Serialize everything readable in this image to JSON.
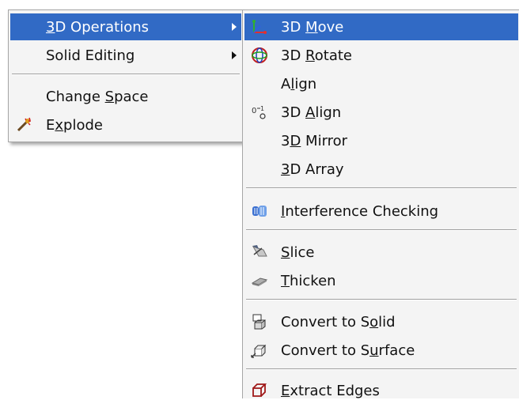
{
  "parent_menu": {
    "items": [
      {
        "label_pre": "",
        "label_ul": "3",
        "label_post": "D Operations",
        "has_submenu": true,
        "highlighted": true
      },
      {
        "label_pre": "Solid Editin",
        "label_ul": "g",
        "label_post": "",
        "has_submenu": true
      },
      {
        "label_pre": "Change ",
        "label_ul": "S",
        "label_post": "pace"
      },
      {
        "label_pre": "E",
        "label_ul": "x",
        "label_post": "plode",
        "icon": "explode-icon"
      }
    ]
  },
  "sub_menu": {
    "items": [
      {
        "label_pre": "3D ",
        "label_ul": "M",
        "label_post": "ove",
        "icon": "move-icon",
        "highlighted": true
      },
      {
        "label_pre": "3D ",
        "label_ul": "R",
        "label_post": "otate",
        "icon": "rotate-icon"
      },
      {
        "label_pre": "A",
        "label_ul": "l",
        "label_post": "ign"
      },
      {
        "label_pre": "3D ",
        "label_ul": "A",
        "label_post": "lign",
        "icon": "align-3d-icon"
      },
      {
        "label_pre": "3",
        "label_ul": "D",
        "label_post": " Mirror"
      },
      {
        "label_pre": "",
        "label_ul": "3",
        "label_post": "D Array"
      },
      {
        "label_pre": "",
        "label_ul": "I",
        "label_post": "nterference Checking",
        "icon": "interference-icon"
      },
      {
        "label_pre": "",
        "label_ul": "S",
        "label_post": "lice",
        "icon": "slice-icon"
      },
      {
        "label_pre": "",
        "label_ul": "T",
        "label_post": "hicken",
        "icon": "thicken-icon"
      },
      {
        "label_pre": "Convert to S",
        "label_ul": "o",
        "label_post": "lid",
        "icon": "convert-solid-icon"
      },
      {
        "label_pre": "Convert to S",
        "label_ul": "u",
        "label_post": "rface",
        "icon": "convert-surface-icon"
      },
      {
        "label_pre": "",
        "label_ul": "E",
        "label_post": "xtract Edges",
        "icon": "extract-edges-icon"
      }
    ]
  },
  "colors": {
    "highlight": "#316ac5",
    "menu_bg": "#f4f4f4"
  }
}
